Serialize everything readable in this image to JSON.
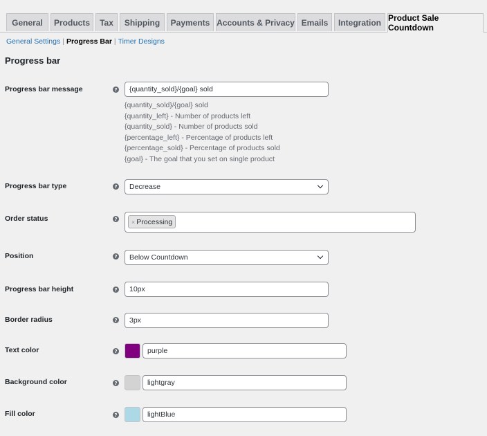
{
  "tabs": [
    {
      "label": "General"
    },
    {
      "label": "Products"
    },
    {
      "label": "Tax"
    },
    {
      "label": "Shipping"
    },
    {
      "label": "Payments"
    },
    {
      "label": "Accounts & Privacy"
    },
    {
      "label": "Emails"
    },
    {
      "label": "Integration"
    },
    {
      "label": "Product Sale Countdown",
      "active": true
    }
  ],
  "subnav": {
    "general_settings": "General Settings",
    "sep": "|",
    "progress_bar": "Progress Bar",
    "timer_designs": "Timer Designs"
  },
  "section_title": "Progress bar",
  "help_glyph": "?",
  "fields": {
    "message": {
      "label": "Progress bar message",
      "value": "{quantity_sold}/{goal} sold",
      "description": [
        "{quantity_sold}/{goal} sold",
        "{quantity_left} - Number of products left",
        "{quantity_sold} - Number of products sold",
        "{percentage_left} - Percentage of products left",
        "{percentage_sold} - Percentage of products sold",
        "{goal} - The goal that you set on single product"
      ]
    },
    "type": {
      "label": "Progress bar type",
      "value": "Decrease"
    },
    "order_status": {
      "label": "Order status",
      "chip": "Processing",
      "chip_remove": "×"
    },
    "position": {
      "label": "Position",
      "value": "Below Countdown"
    },
    "height": {
      "label": "Progress bar height",
      "value": "10px"
    },
    "border_radius": {
      "label": "Border radius",
      "value": "3px"
    },
    "text_color": {
      "label": "Text color",
      "value": "purple",
      "swatch": "#800080"
    },
    "background_color": {
      "label": "Background color",
      "value": "lightgray",
      "swatch": "#d3d3d3"
    },
    "fill_color": {
      "label": "Fill color",
      "value": "lightBlue",
      "swatch": "#add8e6"
    }
  }
}
